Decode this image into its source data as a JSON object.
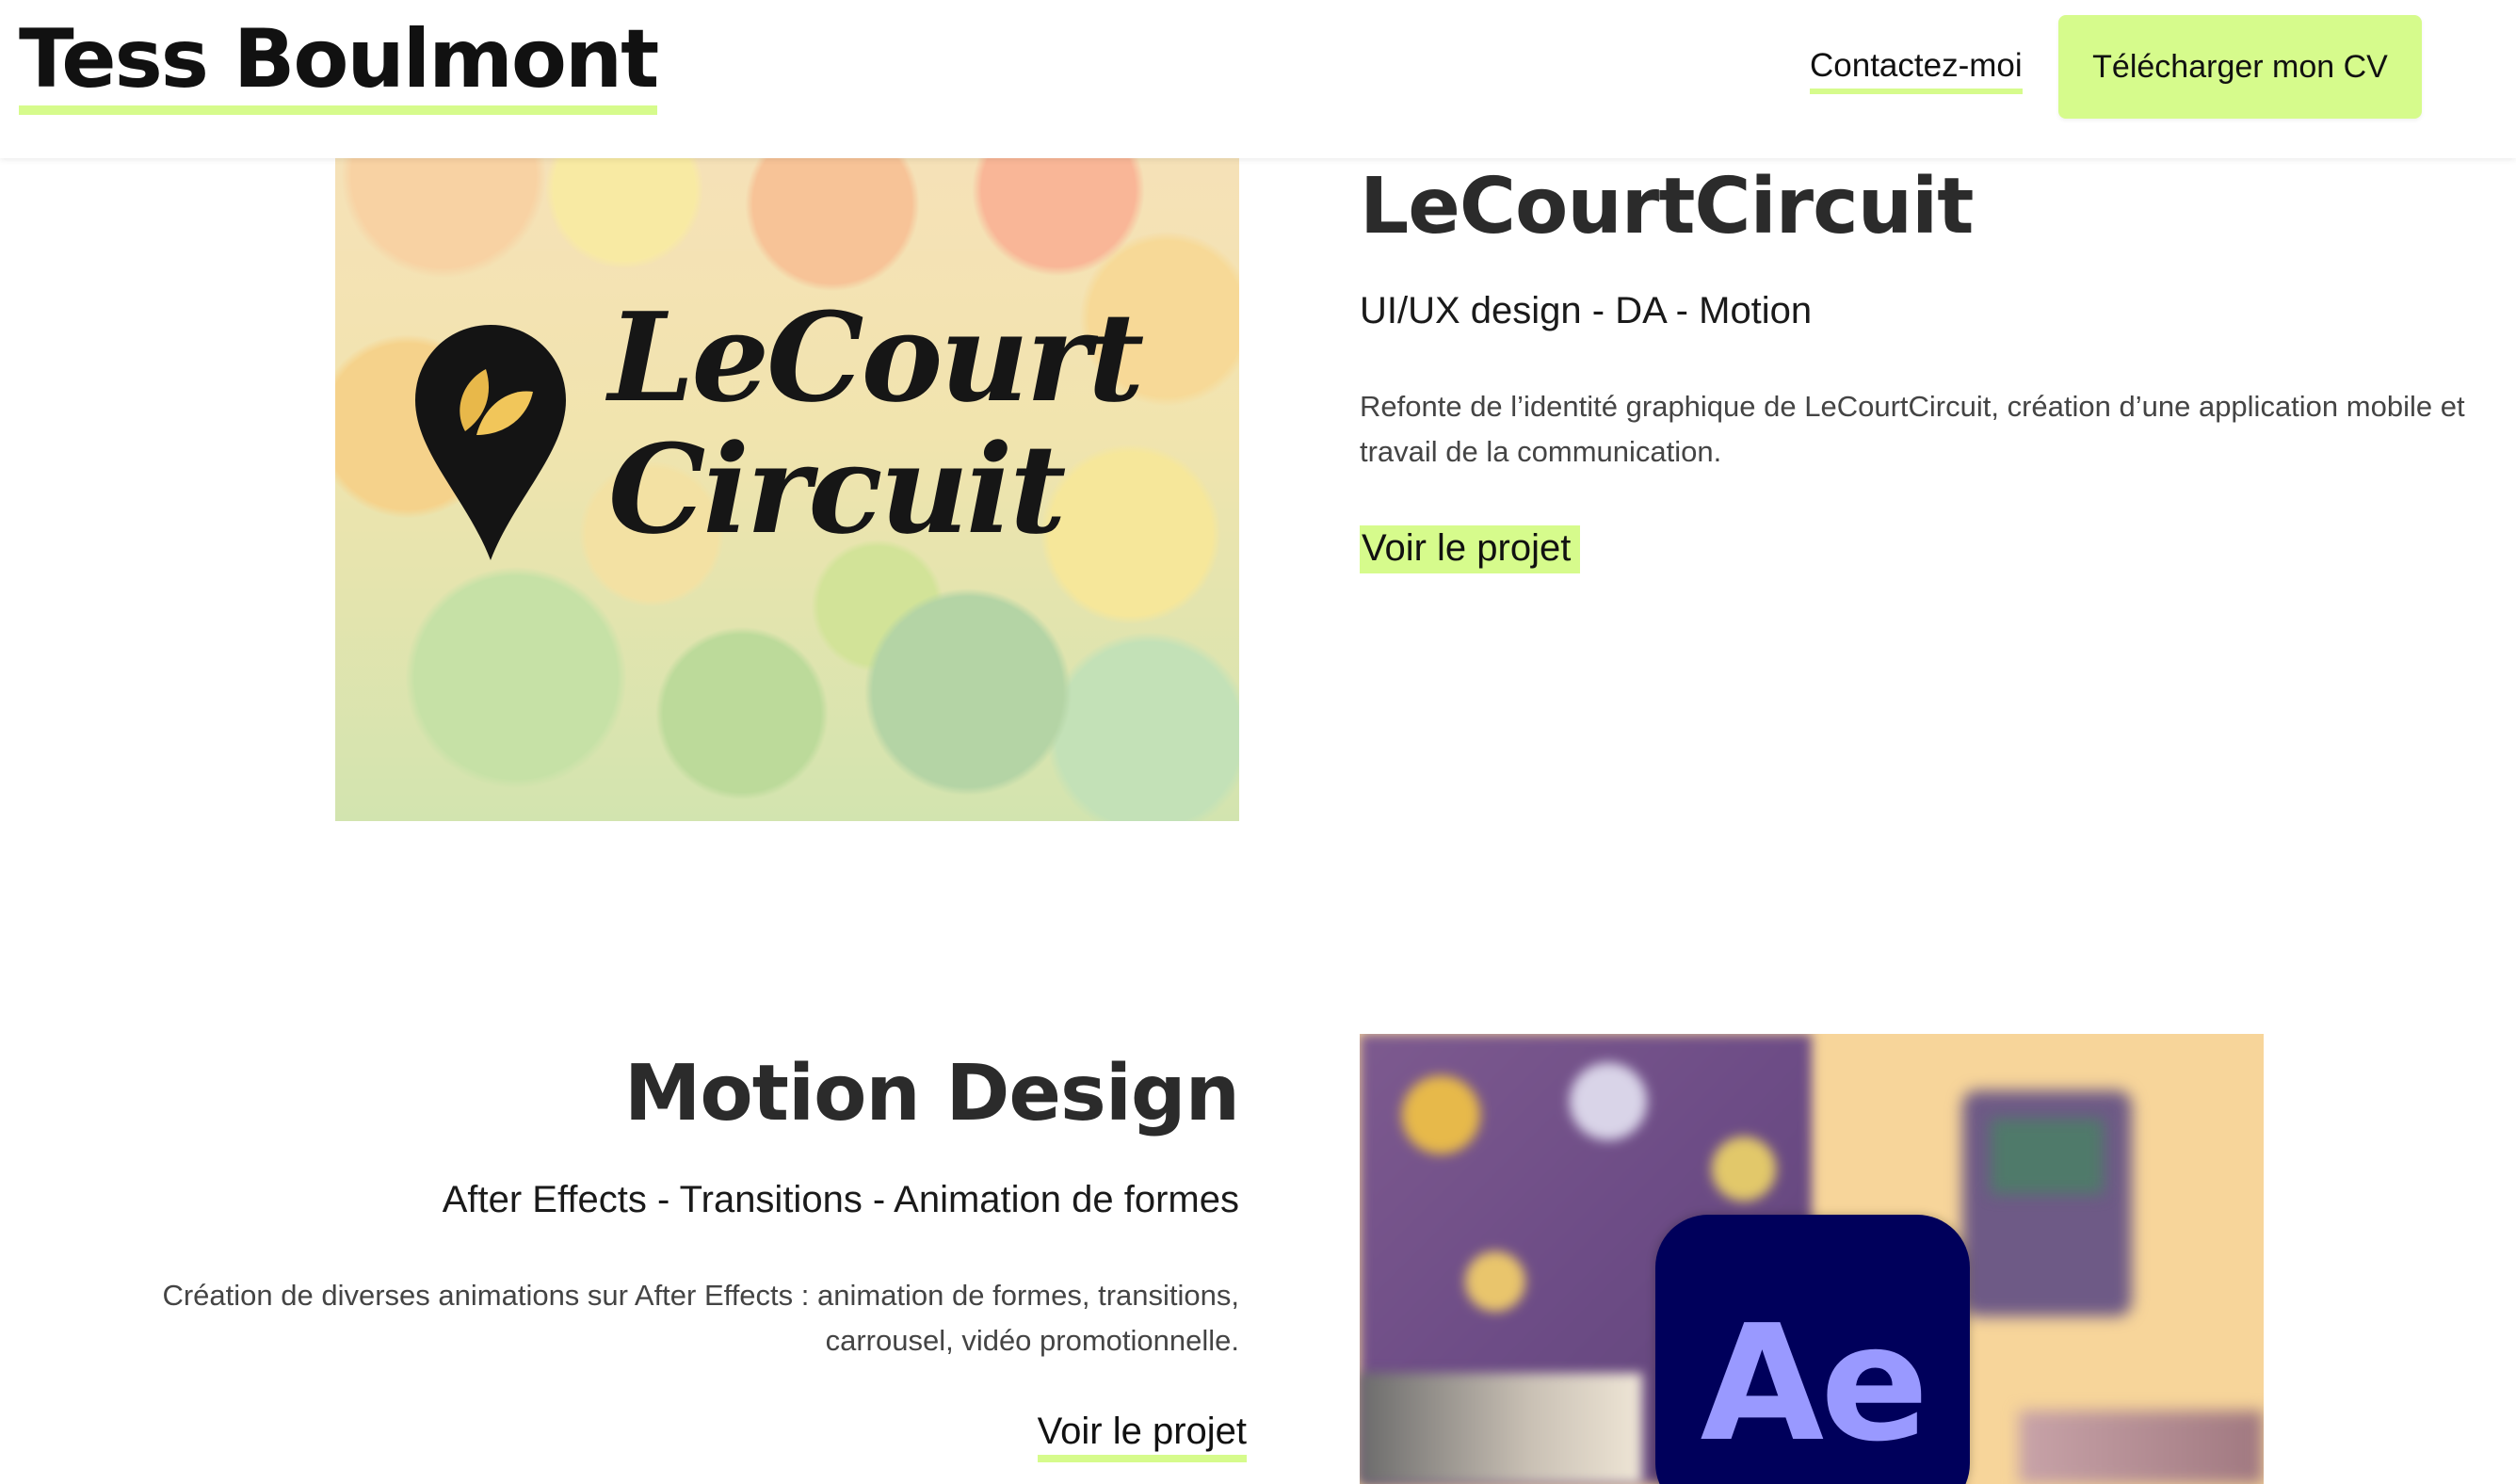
{
  "header": {
    "logo": "Tess Boulmont",
    "contact_label": "Contactez-moi",
    "cv_label": "Télécharger mon CV"
  },
  "projects": [
    {
      "title": "LeCourtCircuit",
      "tags": "UI/UX design - DA - Motion",
      "description": "Refonte de l’identité graphique de LeCourtCircuit, création d’une application mobile et travail de la communication.",
      "link_label": "Voir le projet",
      "image_logo_line1": "LeCourt",
      "image_logo_line2": "Circuit"
    },
    {
      "title": "Motion Design",
      "tags": "After Effects - Transitions - Animation de formes",
      "description": "Création de diverses animations sur After Effects : animation de formes, transitions, carrousel, vidéo promotionnelle.",
      "link_label": "Voir le projet",
      "image_icon_text": "Ae"
    }
  ],
  "colors": {
    "accent": "#d6fb8c",
    "text": "#2b2b2b",
    "ae_bg": "#00005b",
    "ae_text": "#9999ff"
  }
}
